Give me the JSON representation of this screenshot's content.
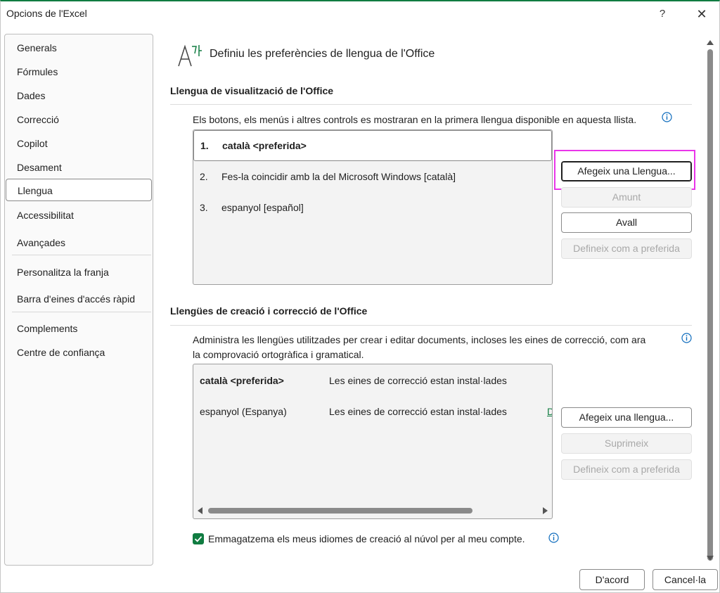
{
  "window": {
    "title": "Opcions de l'Excel",
    "help_glyph": "?",
    "close_glyph": "✕"
  },
  "sidebar": {
    "items": [
      {
        "label": "Generals"
      },
      {
        "label": "Fórmules"
      },
      {
        "label": "Dades"
      },
      {
        "label": "Correcció"
      },
      {
        "label": "Copilot"
      },
      {
        "label": "Desament"
      },
      {
        "label": "Llengua"
      },
      {
        "label": "Accessibilitat"
      },
      {
        "label": "Avançades"
      },
      {
        "label": "Personalitza la franja"
      },
      {
        "label": "Barra d'eines d'accés ràpid"
      },
      {
        "label": "Complements"
      },
      {
        "label": "Centre de confiança"
      }
    ],
    "active": "Llengua"
  },
  "main": {
    "icon": "language-icon",
    "title": "Definiu les preferències de llengua de l'Office",
    "display": {
      "heading": "Llengua de visualització de l'Office",
      "description": "Els botons, els menús i altres controls es mostraran en la primera llengua disponible en aquesta llista.",
      "list": [
        {
          "num": "1.",
          "text": "català <preferida>",
          "selected": true
        },
        {
          "num": "2.",
          "text": "Fes-la coincidir amb la del Microsoft Windows [català]",
          "selected": false
        },
        {
          "num": "3.",
          "text": "espanyol [español]",
          "selected": false
        }
      ],
      "buttons": {
        "add": "Afegeix una Llengua...",
        "up": "Amunt",
        "down": "Avall",
        "set_preferred": "Defineix com a preferida"
      }
    },
    "authoring": {
      "heading": "Llengües de creació i correcció de l'Office",
      "description_line1": "Administra les llengües utilitzades per crear i editar documents, incloses les eines de correcció, com ara",
      "description_line2": "la comprovació ortogràfica i gramatical.",
      "rows": [
        {
          "language": "català <preferida>",
          "status": "Les eines de correcció estan instal·lades",
          "link": ""
        },
        {
          "language": "espanyol (Espanya)",
          "status": "Les eines de correcció estan instal·lades",
          "link": "D"
        }
      ],
      "buttons": {
        "add": "Afegeix una llengua...",
        "remove": "Suprimeix",
        "set_preferred": "Defineix com a preferida"
      }
    },
    "cloud_checkbox": {
      "label": "Emmagatzema els meus idiomes de creació al núvol per al meu compte.",
      "checked": true
    }
  },
  "footer": {
    "ok": "D'acord",
    "cancel": "Cancel·la"
  },
  "colors": {
    "accent": "#107c41",
    "highlight": "#e935e9"
  }
}
